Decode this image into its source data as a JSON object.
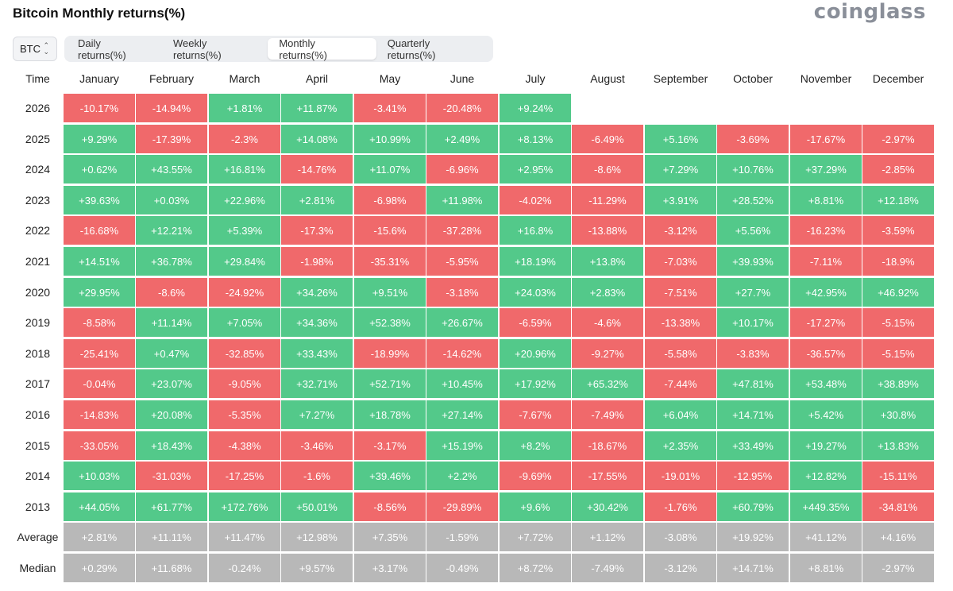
{
  "title": "Bitcoin Monthly returns(%)",
  "brand": "coinglass",
  "asset_select": {
    "value": "BTC",
    "icon": "chevron-up-down-icon"
  },
  "tabs": [
    {
      "label": "Daily returns(%)",
      "active": false
    },
    {
      "label": "Weekly returns(%)",
      "active": false
    },
    {
      "label": "Monthly returns(%)",
      "active": true
    },
    {
      "label": "Quarterly returns(%)",
      "active": false
    }
  ],
  "colors": {
    "positive": "#53c98a",
    "negative": "#f0696b",
    "summary": "#b8b8b8"
  },
  "table": {
    "time_header": "Time",
    "months": [
      "January",
      "February",
      "March",
      "April",
      "May",
      "June",
      "July",
      "August",
      "September",
      "October",
      "November",
      "December"
    ],
    "rows": [
      {
        "label": "2026",
        "values": [
          "-10.17%",
          "-14.94%",
          "+1.81%",
          "+11.87%",
          "-3.41%",
          "-20.48%",
          "+9.24%",
          "",
          "",
          "",
          "",
          ""
        ]
      },
      {
        "label": "2025",
        "values": [
          "+9.29%",
          "-17.39%",
          "-2.3%",
          "+14.08%",
          "+10.99%",
          "+2.49%",
          "+8.13%",
          "-6.49%",
          "+5.16%",
          "-3.69%",
          "-17.67%",
          "-2.97%"
        ]
      },
      {
        "label": "2024",
        "values": [
          "+0.62%",
          "+43.55%",
          "+16.81%",
          "-14.76%",
          "+11.07%",
          "-6.96%",
          "+2.95%",
          "-8.6%",
          "+7.29%",
          "+10.76%",
          "+37.29%",
          "-2.85%"
        ]
      },
      {
        "label": "2023",
        "values": [
          "+39.63%",
          "+0.03%",
          "+22.96%",
          "+2.81%",
          "-6.98%",
          "+11.98%",
          "-4.02%",
          "-11.29%",
          "+3.91%",
          "+28.52%",
          "+8.81%",
          "+12.18%"
        ]
      },
      {
        "label": "2022",
        "values": [
          "-16.68%",
          "+12.21%",
          "+5.39%",
          "-17.3%",
          "-15.6%",
          "-37.28%",
          "+16.8%",
          "-13.88%",
          "-3.12%",
          "+5.56%",
          "-16.23%",
          "-3.59%"
        ]
      },
      {
        "label": "2021",
        "values": [
          "+14.51%",
          "+36.78%",
          "+29.84%",
          "-1.98%",
          "-35.31%",
          "-5.95%",
          "+18.19%",
          "+13.8%",
          "-7.03%",
          "+39.93%",
          "-7.11%",
          "-18.9%"
        ]
      },
      {
        "label": "2020",
        "values": [
          "+29.95%",
          "-8.6%",
          "-24.92%",
          "+34.26%",
          "+9.51%",
          "-3.18%",
          "+24.03%",
          "+2.83%",
          "-7.51%",
          "+27.7%",
          "+42.95%",
          "+46.92%"
        ]
      },
      {
        "label": "2019",
        "values": [
          "-8.58%",
          "+11.14%",
          "+7.05%",
          "+34.36%",
          "+52.38%",
          "+26.67%",
          "-6.59%",
          "-4.6%",
          "-13.38%",
          "+10.17%",
          "-17.27%",
          "-5.15%"
        ]
      },
      {
        "label": "2018",
        "values": [
          "-25.41%",
          "+0.47%",
          "-32.85%",
          "+33.43%",
          "-18.99%",
          "-14.62%",
          "+20.96%",
          "-9.27%",
          "-5.58%",
          "-3.83%",
          "-36.57%",
          "-5.15%"
        ]
      },
      {
        "label": "2017",
        "values": [
          "-0.04%",
          "+23.07%",
          "-9.05%",
          "+32.71%",
          "+52.71%",
          "+10.45%",
          "+17.92%",
          "+65.32%",
          "-7.44%",
          "+47.81%",
          "+53.48%",
          "+38.89%"
        ]
      },
      {
        "label": "2016",
        "values": [
          "-14.83%",
          "+20.08%",
          "-5.35%",
          "+7.27%",
          "+18.78%",
          "+27.14%",
          "-7.67%",
          "-7.49%",
          "+6.04%",
          "+14.71%",
          "+5.42%",
          "+30.8%"
        ]
      },
      {
        "label": "2015",
        "values": [
          "-33.05%",
          "+18.43%",
          "-4.38%",
          "-3.46%",
          "-3.17%",
          "+15.19%",
          "+8.2%",
          "-18.67%",
          "+2.35%",
          "+33.49%",
          "+19.27%",
          "+13.83%"
        ]
      },
      {
        "label": "2014",
        "values": [
          "+10.03%",
          "-31.03%",
          "-17.25%",
          "-1.6%",
          "+39.46%",
          "+2.2%",
          "-9.69%",
          "-17.55%",
          "-19.01%",
          "-12.95%",
          "+12.82%",
          "-15.11%"
        ]
      },
      {
        "label": "2013",
        "values": [
          "+44.05%",
          "+61.77%",
          "+172.76%",
          "+50.01%",
          "-8.56%",
          "-29.89%",
          "+9.6%",
          "+30.42%",
          "-1.76%",
          "+60.79%",
          "+449.35%",
          "-34.81%"
        ]
      },
      {
        "label": "Average",
        "summary": true,
        "values": [
          "+2.81%",
          "+11.11%",
          "+11.47%",
          "+12.98%",
          "+7.35%",
          "-1.59%",
          "+7.72%",
          "+1.12%",
          "-3.08%",
          "+19.92%",
          "+41.12%",
          "+4.16%"
        ]
      },
      {
        "label": "Median",
        "summary": true,
        "values": [
          "+0.29%",
          "+11.68%",
          "-0.24%",
          "+9.57%",
          "+3.17%",
          "-0.49%",
          "+8.72%",
          "-7.49%",
          "-3.12%",
          "+14.71%",
          "+8.81%",
          "-2.97%"
        ]
      }
    ]
  }
}
